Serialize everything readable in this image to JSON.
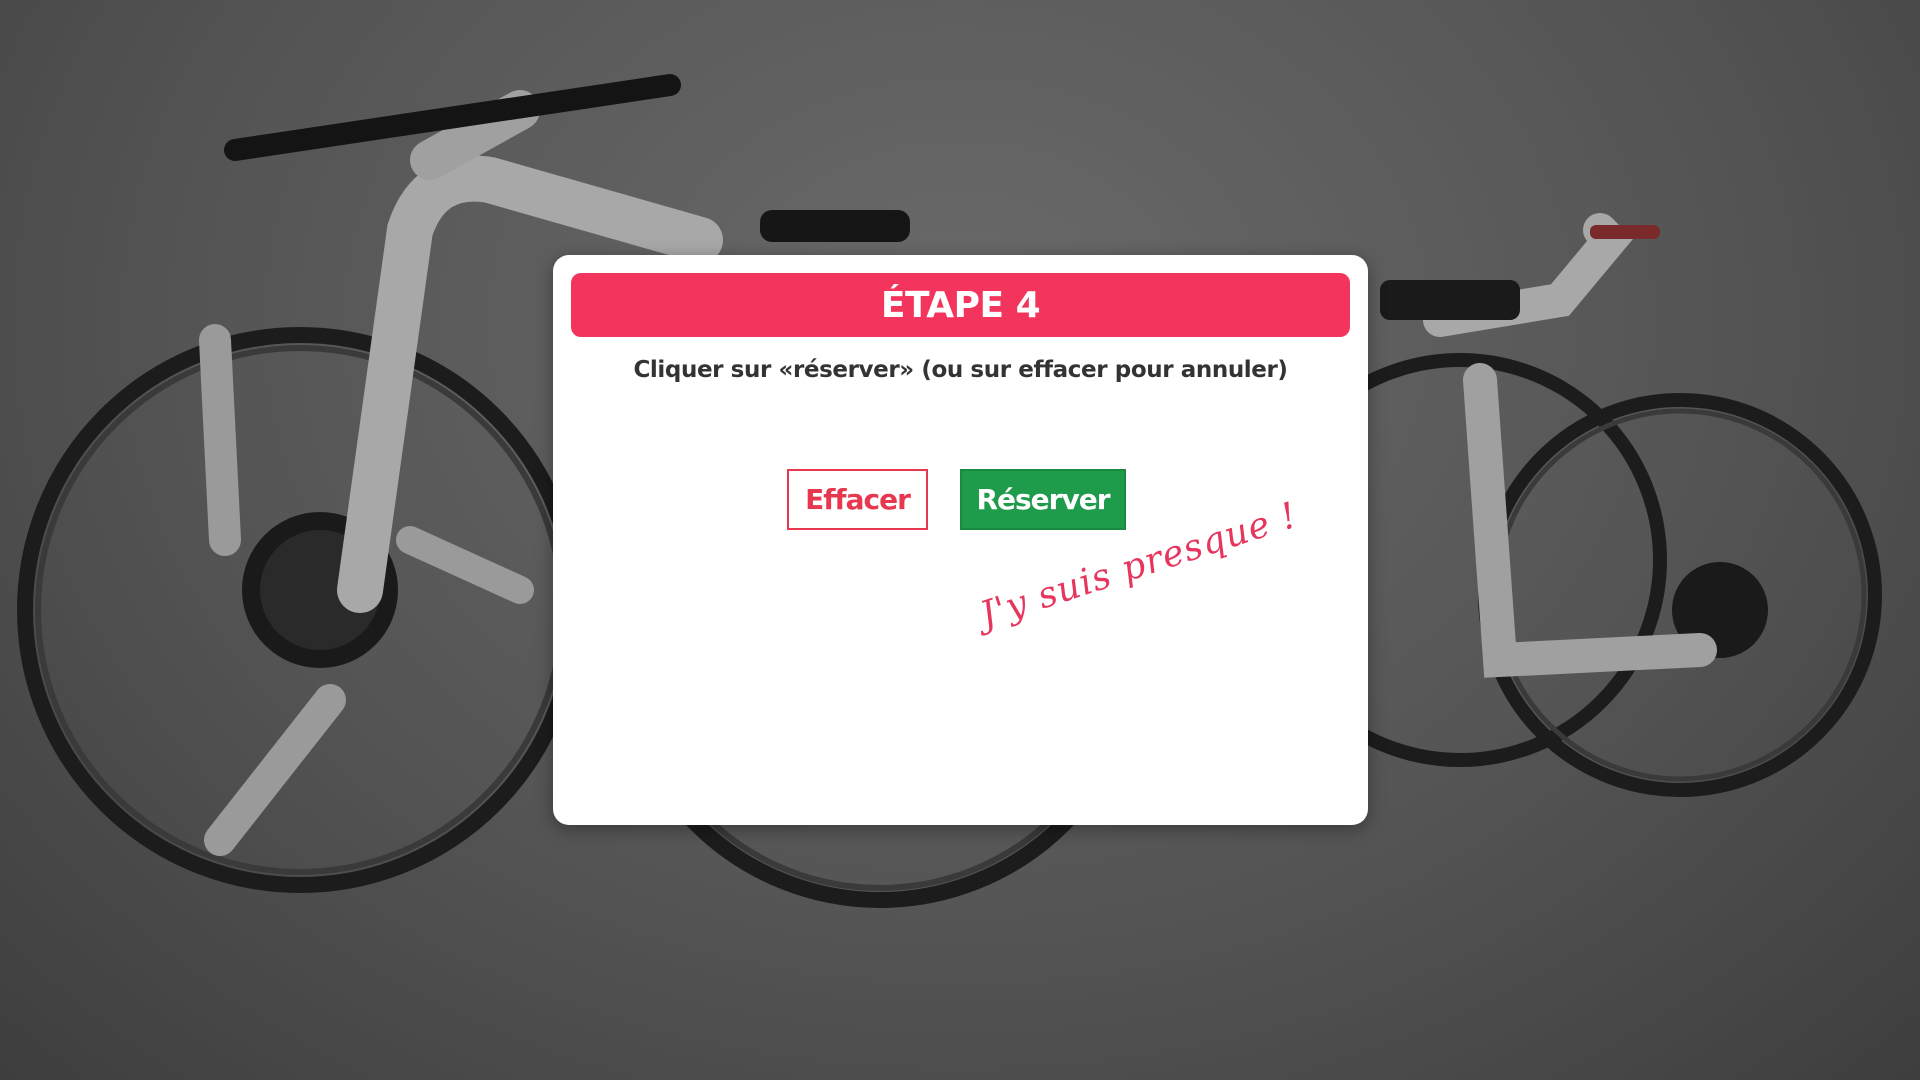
{
  "background": {
    "image": "bicycle-photo"
  },
  "modal": {
    "title": "ÉTAPE 4",
    "instruction": "Cliquer sur «réserver» (ou sur effacer pour annuler)",
    "clear_label": "Effacer",
    "reserve_label": "Réserver",
    "note": "J'y suis presque !"
  },
  "colors": {
    "accent": "#f3345c",
    "clear_border": "#e8384f",
    "reserve_bg": "#1e9c4c",
    "note": "#e6365e"
  }
}
